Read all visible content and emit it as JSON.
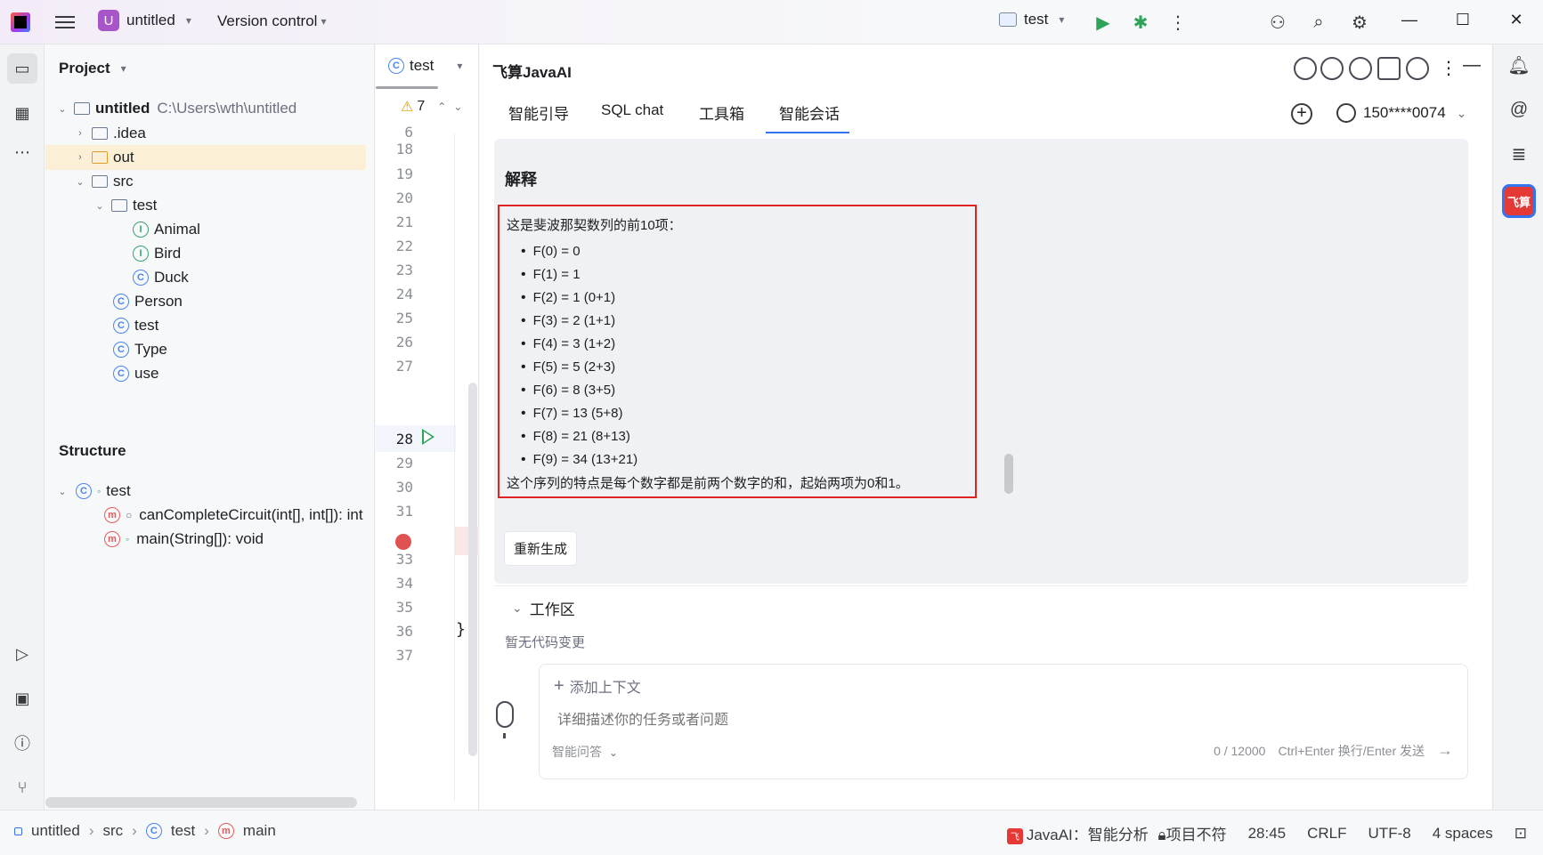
{
  "titlebar": {
    "project_badge": "U",
    "project_name": "untitled",
    "vcs_label": "Version control",
    "run_config": "test"
  },
  "project_panel": {
    "title": "Project",
    "root_name": "untitled",
    "root_path": "C:\\Users\\wth\\untitled",
    "items": [
      {
        "label": ".idea"
      },
      {
        "label": "out"
      },
      {
        "label": "src"
      },
      {
        "label": "test"
      },
      {
        "label": "Animal"
      },
      {
        "label": "Bird"
      },
      {
        "label": "Duck"
      },
      {
        "label": "Person"
      },
      {
        "label": "test"
      },
      {
        "label": "Type"
      },
      {
        "label": "use"
      }
    ]
  },
  "structure": {
    "title": "Structure",
    "root": "test",
    "members": [
      {
        "label": "canCompleteCircuit(int[], int[]): int"
      },
      {
        "label": "main(String[]): void"
      }
    ]
  },
  "editor": {
    "tab_label": "test",
    "warning_count": "7",
    "line_numbers": [
      "6",
      "18",
      "19",
      "20",
      "21",
      "22",
      "23",
      "24",
      "25",
      "26",
      "27",
      "28",
      "29",
      "30",
      "31",
      "33",
      "34",
      "35",
      "36",
      "37"
    ],
    "closing_brace": "}"
  },
  "ai": {
    "title": "飞算JavaAI",
    "tabs": [
      "智能引导",
      "SQL chat",
      "工具箱",
      "智能会话"
    ],
    "active_tab": "智能会话",
    "user": "150****0074",
    "explanation_title": "解释",
    "intro": "这是斐波那契数列的前10项：",
    "fib_items": [
      "F(0) = 0",
      "F(1) = 1",
      "F(2) = 1 (0+1)",
      "F(3) = 2 (1+1)",
      "F(4) = 3 (1+2)",
      "F(5) = 5 (2+3)",
      "F(6) = 8 (3+5)",
      "F(7) = 13 (5+8)",
      "F(8) = 21 (8+13)",
      "F(9) = 34 (13+21)"
    ],
    "outro": "这个序列的特点是每个数字都是前两个数字的和，起始两项为0和1。",
    "regenerate": "重新生成",
    "workspace_title": "工作区",
    "workspace_empty": "暂无代码变更",
    "add_context": "添加上下文",
    "prompt_placeholder": "详细描述你的任务或者问题",
    "mode": "智能问答",
    "counter": "0 / 12000",
    "send_hint": "Ctrl+Enter 换行/Enter 发送"
  },
  "status": {
    "crumbs": [
      "untitled",
      "src",
      "test",
      "main"
    ],
    "javaai": "JavaAI：智能分析",
    "lock_text": "项目不符",
    "position": "28:45",
    "line_sep": "CRLF",
    "encoding": "UTF-8",
    "indent": "4 spaces"
  },
  "right_strip": {
    "feisuan_label": "飞算"
  },
  "colors": {
    "accent": "#3574f0",
    "highlight_box": "#e02424",
    "breakpoint": "#e05252"
  }
}
